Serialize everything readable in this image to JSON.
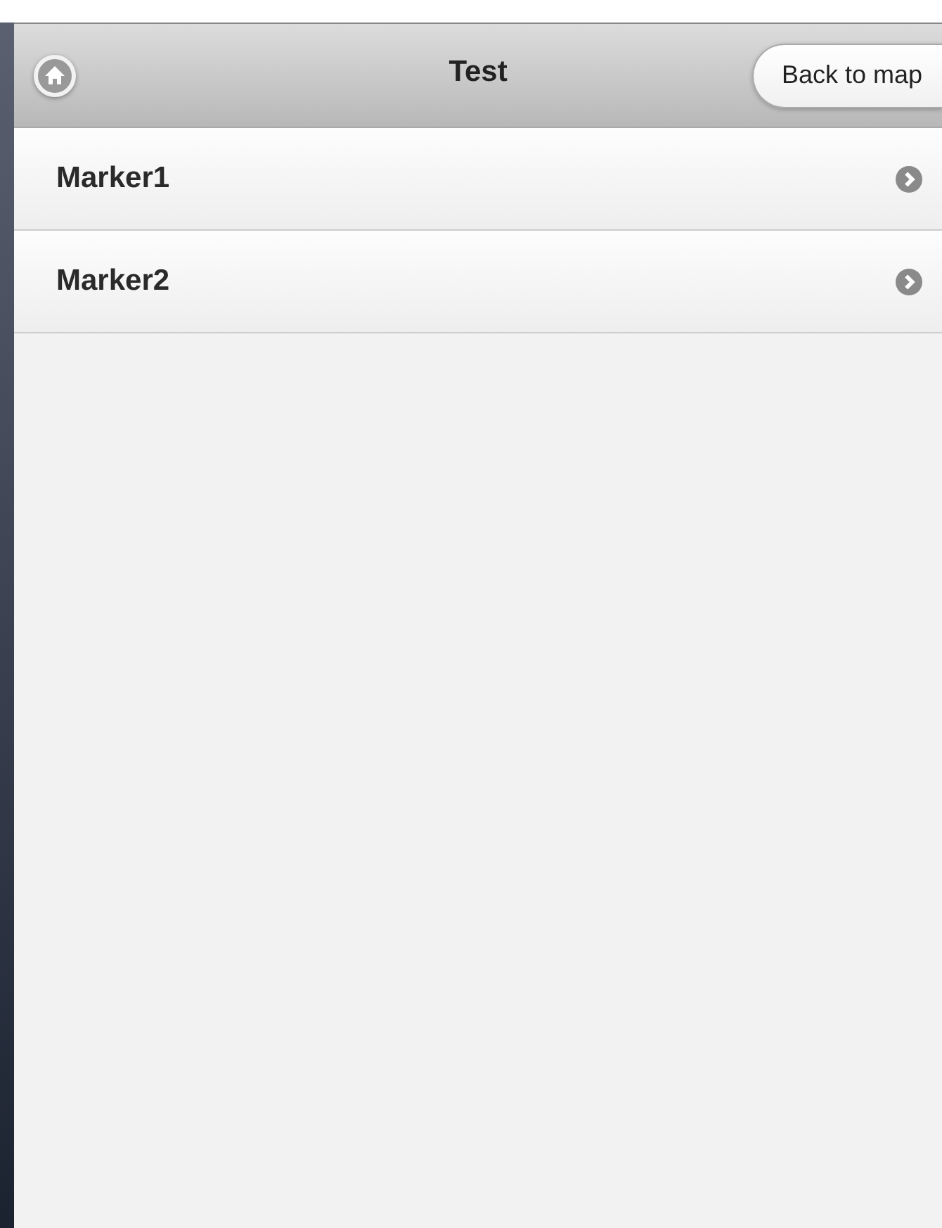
{
  "header": {
    "title": "Test",
    "back_button": "Back to map"
  },
  "list": [
    {
      "label": "Marker1"
    },
    {
      "label": "Marker2"
    }
  ]
}
